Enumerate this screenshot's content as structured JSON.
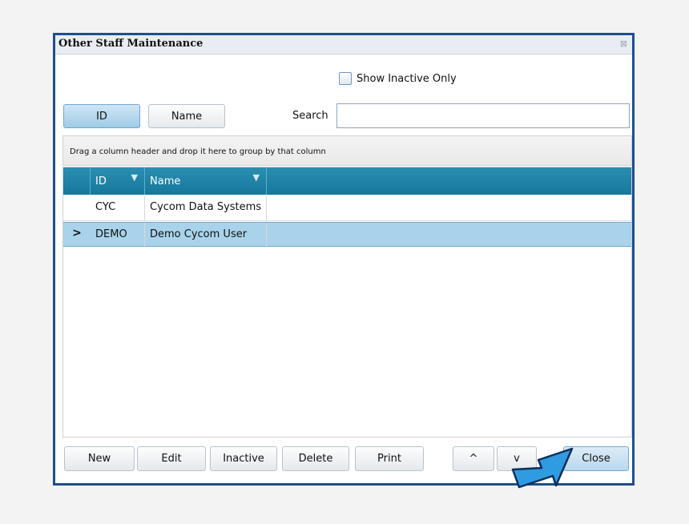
{
  "window": {
    "title": "Other Staff Maintenance"
  },
  "filters": {
    "show_inactive_label": "Show Inactive Only",
    "show_inactive_checked": false
  },
  "search": {
    "mode_buttons": [
      {
        "label": "ID",
        "active": true
      },
      {
        "label": "Name",
        "active": false
      }
    ],
    "label": "Search",
    "value": ""
  },
  "grid": {
    "group_hint": "Drag a column header and drop it here to group by that column",
    "columns": [
      "ID",
      "Name"
    ],
    "rows": [
      {
        "id": "CYC",
        "name": "Cycom Data Systems",
        "selected": false
      },
      {
        "id": "DEMO",
        "name": "Demo Cycom User",
        "selected": true
      }
    ],
    "row_indicator": ">"
  },
  "buttons": {
    "new": "New",
    "edit": "Edit",
    "inactive": "Inactive",
    "delete": "Delete",
    "print": "Print",
    "up": "^",
    "down": "v",
    "close": "Close"
  },
  "colors": {
    "header": "#1f84a8",
    "selection": "#a9d3ea",
    "frame": "#1f4e8c",
    "arrow": "#2f9be0"
  },
  "icons": {
    "filter": "funnel-icon",
    "close": "close-icon",
    "pointer": "arrow-pointer-icon"
  }
}
